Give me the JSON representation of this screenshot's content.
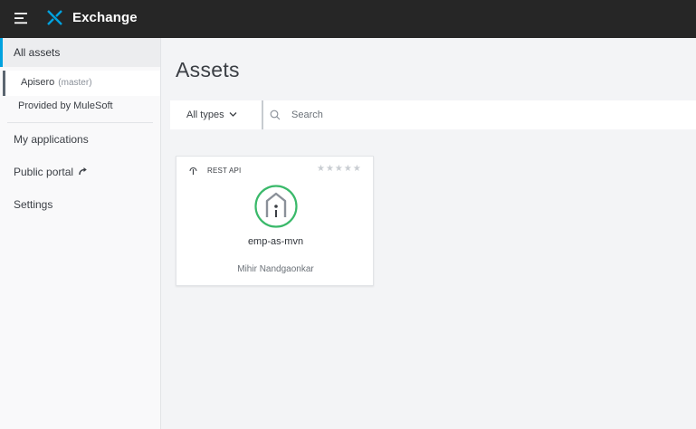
{
  "app": {
    "title": "Exchange",
    "brand_color": "#00a2df"
  },
  "icons": {
    "menu": "hamburger-menu-icon",
    "logo": "exchange-logo-icon",
    "search": "search-icon",
    "external": "external-link-icon",
    "api": "rest-api-icon",
    "asset": "api-asset-icon"
  },
  "sidebar": {
    "all_assets": "All assets",
    "org": {
      "name": "Apisero",
      "branch": "(master)"
    },
    "provided": "Provided by MuleSoft",
    "my_apps": "My applications",
    "public_portal": "Public portal",
    "settings": "Settings"
  },
  "main": {
    "title": "Assets",
    "filter": {
      "types_label": "All types"
    },
    "search": {
      "placeholder": "Search"
    }
  },
  "cards": [
    {
      "type": "REST API",
      "name": "emp-as-mvn",
      "owner": "Mihir Nandgaonkar",
      "rating": 0,
      "rating_max": 5,
      "stars": "★★★★★",
      "icon_ring_color": "#3ab96a"
    }
  ]
}
